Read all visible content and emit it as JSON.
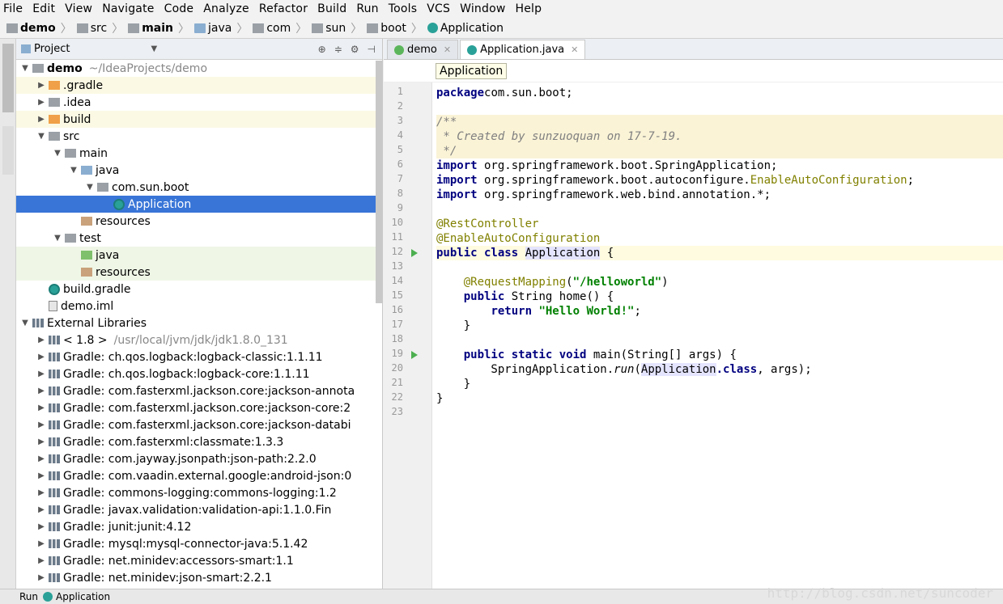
{
  "menu": [
    "File",
    "Edit",
    "View",
    "Navigate",
    "Code",
    "Analyze",
    "Refactor",
    "Build",
    "Run",
    "Tools",
    "VCS",
    "Window",
    "Help"
  ],
  "breadcrumbs": [
    "demo",
    "src",
    "main",
    "java",
    "com",
    "sun",
    "boot",
    "Application"
  ],
  "project_panel": {
    "title": "Project",
    "rows": [
      {
        "label": "demo",
        "extra": "~/IdeaProjects/demo",
        "depth": 0,
        "arrow": "▼",
        "icon": "fi-gray",
        "cls": ""
      },
      {
        "label": ".gradle",
        "extra": "",
        "depth": 1,
        "arrow": "▶",
        "icon": "fi-orange",
        "cls": "hl-y"
      },
      {
        "label": ".idea",
        "extra": "",
        "depth": 1,
        "arrow": "▶",
        "icon": "fi-gray",
        "cls": ""
      },
      {
        "label": "build",
        "extra": "",
        "depth": 1,
        "arrow": "▶",
        "icon": "fi-orange",
        "cls": "hl-y"
      },
      {
        "label": "src",
        "extra": "",
        "depth": 1,
        "arrow": "▼",
        "icon": "fi-gray",
        "cls": ""
      },
      {
        "label": "main",
        "extra": "",
        "depth": 2,
        "arrow": "▼",
        "icon": "fi-gray",
        "cls": ""
      },
      {
        "label": "java",
        "extra": "",
        "depth": 3,
        "arrow": "▼",
        "icon": "fi-blue",
        "cls": ""
      },
      {
        "label": "com.sun.boot",
        "extra": "",
        "depth": 4,
        "arrow": "▼",
        "icon": "fi-gray",
        "cls": ""
      },
      {
        "label": "Application",
        "extra": "",
        "depth": 5,
        "arrow": "",
        "icon": "fi-app",
        "cls": "sel"
      },
      {
        "label": "resources",
        "extra": "",
        "depth": 3,
        "arrow": "",
        "icon": "fi-res",
        "cls": ""
      },
      {
        "label": "test",
        "extra": "",
        "depth": 2,
        "arrow": "▼",
        "icon": "fi-gray",
        "cls": ""
      },
      {
        "label": "java",
        "extra": "",
        "depth": 3,
        "arrow": "",
        "icon": "fi-green",
        "cls": "hl-g"
      },
      {
        "label": "resources",
        "extra": "",
        "depth": 3,
        "arrow": "",
        "icon": "fi-res",
        "cls": "hl-g"
      },
      {
        "label": "build.gradle",
        "extra": "",
        "depth": 1,
        "arrow": "",
        "icon": "fi-app",
        "cls": ""
      },
      {
        "label": "demo.iml",
        "extra": "",
        "depth": 1,
        "arrow": "",
        "icon": "fi-file",
        "cls": ""
      },
      {
        "label": "External Libraries",
        "extra": "",
        "depth": 0,
        "arrow": "▼",
        "icon": "fi-lib",
        "cls": ""
      },
      {
        "label": "< 1.8 >",
        "extra": "/usr/local/jvm/jdk/jdk1.8.0_131",
        "depth": 1,
        "arrow": "▶",
        "icon": "fi-lib",
        "cls": ""
      },
      {
        "label": "Gradle: ch.qos.logback:logback-classic:1.1.11",
        "extra": "",
        "depth": 1,
        "arrow": "▶",
        "icon": "fi-lib",
        "cls": ""
      },
      {
        "label": "Gradle: ch.qos.logback:logback-core:1.1.11",
        "extra": "",
        "depth": 1,
        "arrow": "▶",
        "icon": "fi-lib",
        "cls": ""
      },
      {
        "label": "Gradle: com.fasterxml.jackson.core:jackson-annota",
        "extra": "",
        "depth": 1,
        "arrow": "▶",
        "icon": "fi-lib",
        "cls": ""
      },
      {
        "label": "Gradle: com.fasterxml.jackson.core:jackson-core:2",
        "extra": "",
        "depth": 1,
        "arrow": "▶",
        "icon": "fi-lib",
        "cls": ""
      },
      {
        "label": "Gradle: com.fasterxml.jackson.core:jackson-databi",
        "extra": "",
        "depth": 1,
        "arrow": "▶",
        "icon": "fi-lib",
        "cls": ""
      },
      {
        "label": "Gradle: com.fasterxml:classmate:1.3.3",
        "extra": "",
        "depth": 1,
        "arrow": "▶",
        "icon": "fi-lib",
        "cls": ""
      },
      {
        "label": "Gradle: com.jayway.jsonpath:json-path:2.2.0",
        "extra": "",
        "depth": 1,
        "arrow": "▶",
        "icon": "fi-lib",
        "cls": ""
      },
      {
        "label": "Gradle: com.vaadin.external.google:android-json:0",
        "extra": "",
        "depth": 1,
        "arrow": "▶",
        "icon": "fi-lib",
        "cls": ""
      },
      {
        "label": "Gradle: commons-logging:commons-logging:1.2",
        "extra": "",
        "depth": 1,
        "arrow": "▶",
        "icon": "fi-lib",
        "cls": ""
      },
      {
        "label": "Gradle: javax.validation:validation-api:1.1.0.Fin",
        "extra": "",
        "depth": 1,
        "arrow": "▶",
        "icon": "fi-lib",
        "cls": ""
      },
      {
        "label": "Gradle: junit:junit:4.12",
        "extra": "",
        "depth": 1,
        "arrow": "▶",
        "icon": "fi-lib",
        "cls": ""
      },
      {
        "label": "Gradle: mysql:mysql-connector-java:5.1.42",
        "extra": "",
        "depth": 1,
        "arrow": "▶",
        "icon": "fi-lib",
        "cls": ""
      },
      {
        "label": "Gradle: net.minidev:accessors-smart:1.1",
        "extra": "",
        "depth": 1,
        "arrow": "▶",
        "icon": "fi-lib",
        "cls": ""
      },
      {
        "label": "Gradle: net.minidev:json-smart:2.2.1",
        "extra": "",
        "depth": 1,
        "arrow": "▶",
        "icon": "fi-lib",
        "cls": ""
      }
    ]
  },
  "editor": {
    "tabs": [
      {
        "label": "demo",
        "active": false
      },
      {
        "label": "Application.java",
        "active": true
      }
    ],
    "breadcrumb": "Application",
    "lines": [
      [
        [
          "k",
          "package"
        ],
        [
          "",
          "com.sun.boot;"
        ]
      ],
      [],
      [
        [
          "cmt",
          "/**"
        ]
      ],
      [
        [
          "cmt",
          " * Created by sunzuoquan on 17-7-19."
        ]
      ],
      [
        [
          "cmt",
          " */"
        ]
      ],
      [
        [
          "k",
          "import"
        ],
        [
          "",
          " org.springframework.boot.SpringApplication;"
        ]
      ],
      [
        [
          "k",
          "import"
        ],
        [
          "",
          " org.springframework.boot.autoconfigure."
        ],
        [
          "ann",
          "EnableAutoConfiguration"
        ],
        [
          "",
          ";"
        ]
      ],
      [
        [
          "k",
          "import"
        ],
        [
          "",
          " org.springframework.web.bind.annotation.*;"
        ]
      ],
      [],
      [
        [
          "ann",
          "@RestController"
        ]
      ],
      [
        [
          "ann",
          "@EnableAutoConfiguration"
        ]
      ],
      [
        [
          "k",
          "public class"
        ],
        [
          "",
          " "
        ],
        [
          "hl",
          "Application"
        ],
        [
          "",
          " {"
        ]
      ],
      [],
      [
        [
          "",
          "    "
        ],
        [
          "ann",
          "@RequestMapping"
        ],
        [
          "",
          "("
        ],
        [
          "str",
          "\"/helloworld\""
        ],
        [
          "",
          ")"
        ]
      ],
      [
        [
          "",
          "    "
        ],
        [
          "k",
          "public"
        ],
        [
          "",
          " String home() {"
        ]
      ],
      [
        [
          "",
          "        "
        ],
        [
          "k",
          "return"
        ],
        [
          "",
          " "
        ],
        [
          "str",
          "\"Hello World!\""
        ],
        [
          "",
          ";"
        ]
      ],
      [
        [
          "",
          "    }"
        ]
      ],
      [],
      [
        [
          "",
          "    "
        ],
        [
          "k",
          "public static void"
        ],
        [
          "",
          " main(String[] args) {"
        ]
      ],
      [
        [
          "",
          "        SpringApplication."
        ],
        [
          "ital",
          "run"
        ],
        [
          "",
          "("
        ],
        [
          "hl",
          "Application"
        ],
        [
          "k",
          ".class"
        ],
        [
          "",
          ", args);"
        ]
      ],
      [
        [
          "",
          "    }"
        ]
      ],
      [
        [
          "",
          "}"
        ]
      ],
      []
    ],
    "line_bg": {
      "3": "bg-y",
      "4": "bg-y",
      "5": "bg-y",
      "12": "bg-cur"
    },
    "run_markers": [
      12,
      19
    ]
  },
  "status": {
    "run_label": "Run",
    "config": "Application"
  },
  "watermark": "http://blog.csdn.net/suncoder"
}
